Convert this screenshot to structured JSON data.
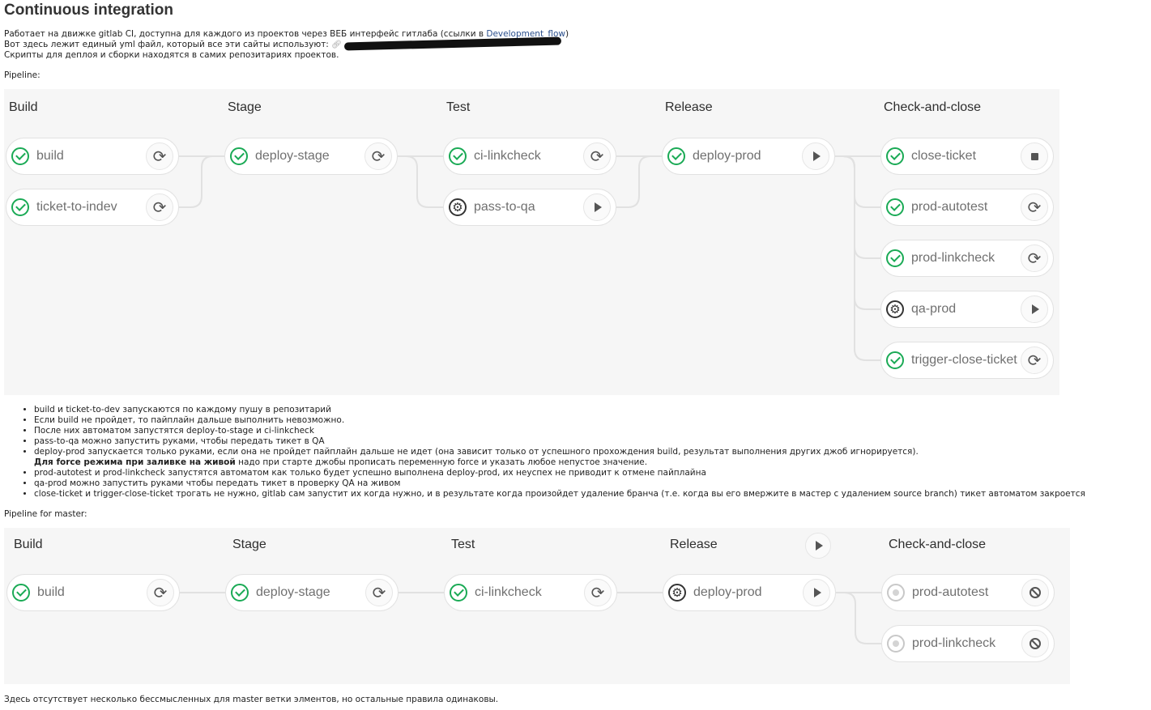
{
  "title": "Continuous integration",
  "intro": {
    "line1_text": "Работает на движке gitlab CI, доступна для каждого из проектов через ВЕБ интерфейс гитлаба (ссылки в ",
    "line1_link": "Development_flow",
    "line1_end": ")",
    "line2_text": "Вот здесь лежит единый yml файл, который все эти сайты используют: ",
    "line3": "Скрипты для деплоя и сборки находятся в самих репозитариях проектов.",
    "pipeline_label": "Pipeline:"
  },
  "pipeline": {
    "stages": [
      {
        "title": "Build",
        "jobs": [
          {
            "name": "build",
            "status": "success",
            "action": "retry"
          },
          {
            "name": "ticket-to-indev",
            "status": "success",
            "action": "retry"
          }
        ]
      },
      {
        "title": "Stage",
        "jobs": [
          {
            "name": "deploy-stage",
            "status": "success",
            "action": "retry"
          }
        ]
      },
      {
        "title": "Test",
        "jobs": [
          {
            "name": "ci-linkcheck",
            "status": "success",
            "action": "retry"
          },
          {
            "name": "pass-to-qa",
            "status": "manual",
            "action": "play"
          }
        ]
      },
      {
        "title": "Release",
        "jobs": [
          {
            "name": "deploy-prod",
            "status": "success",
            "action": "play"
          }
        ]
      },
      {
        "title": "Check-and-close",
        "jobs": [
          {
            "name": "close-ticket",
            "status": "success",
            "action": "stop"
          },
          {
            "name": "prod-autotest",
            "status": "success",
            "action": "retry"
          },
          {
            "name": "prod-linkcheck",
            "status": "success",
            "action": "retry"
          },
          {
            "name": "qa-prod",
            "status": "manual",
            "action": "play"
          },
          {
            "name": "trigger-close-ticket",
            "status": "success",
            "action": "retry"
          }
        ]
      }
    ]
  },
  "notes": [
    {
      "text": "build и ticket-to-dev запускаются по каждому пушу в репозитарий"
    },
    {
      "text": "Если build не пройдет, то пайплайн дальше выполнить невозможно."
    },
    {
      "text": "После них автоматом запустятся deploy-to-stage и ci-linkcheck"
    },
    {
      "text": "pass-to-qa можно запустить руками, чтобы передать тикет в QA"
    },
    {
      "text": "deploy-prod запускается только руками, если она не пройдет пайплайн дальше не идет (она зависит только от успешного прохождения build, результат выполнения других джоб игнорируется).",
      "bold": "Для force режима при заливке на живой",
      "rest": " надо при старте джобы прописать переменную force и указать любое непустое значение."
    },
    {
      "text": "prod-autotest и prod-linkcheck запустятся автоматом как только будет успешно выполнена deploy-prod, их неуспех не приводит к отмене пайплайна"
    },
    {
      "text": "qa-prod можно запустить руками чтобы передать тикет в проверку QA на живом"
    },
    {
      "text": "close-ticket и trigger-close-ticket трогать не нужно, gitlab сам запустит их когда нужно, и в результате когда произойдет удаление бранча (т.е. когда вы его вмержите в мастер с удалением source branch) тикет автоматом закроется"
    }
  ],
  "master_label": "Pipeline for master:",
  "master_pipeline": {
    "stages": [
      {
        "title": "Build",
        "jobs": [
          {
            "name": "build",
            "status": "success",
            "action": "retry"
          }
        ]
      },
      {
        "title": "Stage",
        "jobs": [
          {
            "name": "deploy-stage",
            "status": "success",
            "action": "retry"
          }
        ]
      },
      {
        "title": "Test",
        "jobs": [
          {
            "name": "ci-linkcheck",
            "status": "success",
            "action": "retry"
          }
        ]
      },
      {
        "title": "Release",
        "stage_action": "play",
        "jobs": [
          {
            "name": "deploy-prod",
            "status": "manual",
            "action": "play"
          }
        ]
      },
      {
        "title": "Check-and-close",
        "jobs": [
          {
            "name": "prod-autotest",
            "status": "skipped",
            "action": "cancel"
          },
          {
            "name": "prod-linkcheck",
            "status": "skipped",
            "action": "cancel"
          }
        ]
      }
    ]
  },
  "footer": "Здесь отсутствует несколько бессмысленных для master ветки элментов, но остальные правила одинаковы."
}
